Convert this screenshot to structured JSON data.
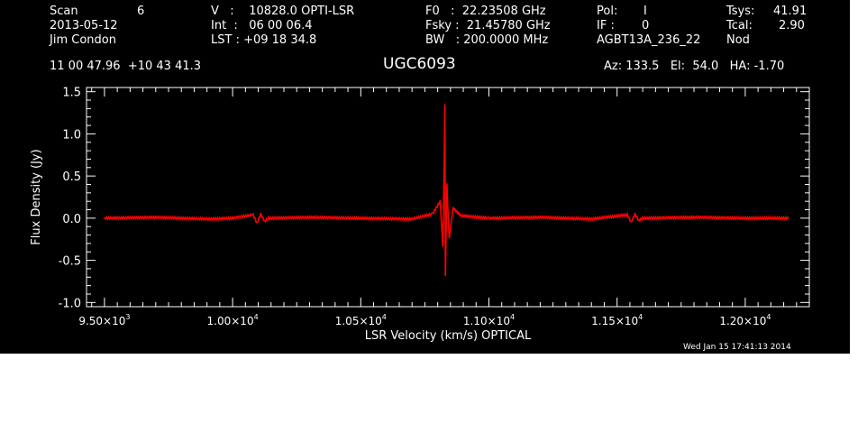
{
  "header": {
    "scan_label": "Scan",
    "scan_value": "6",
    "date": "2013-05-12",
    "observer": "Jim Condon",
    "v_line": "V   :    10828.0 OPTI-LSR",
    "int_line": "Int  :   06 00 06.4",
    "lst_line": "LST : +09 18 34.8",
    "f0_line": "F0   :  22.23508 GHz",
    "fsky_line": "Fsky :  21.45780 GHz",
    "bw_line": "BW   : 200.0000 MHz",
    "pol_label": "Pol:",
    "pol_value": "I",
    "if_label": "IF :",
    "if_value": "0",
    "project": "AGBT13A_236_22",
    "tsys_label": "Tsys:",
    "tsys_value": "41.91",
    "tcal_label": "Tcal:",
    "tcal_value": "2.90",
    "mode": "Nod",
    "coords": "11 00 47.96  +10 43 41.3",
    "source": "UGC6093",
    "az_el_ha": "Az: 133.5   El:  54.0   HA: -1.70"
  },
  "footer": {
    "timestamp": "Wed Jan 15 17:41:13 2014"
  },
  "colors": {
    "background": "#000000",
    "axes": "#ffffff",
    "trace": "#ff0000"
  },
  "chart_data": {
    "type": "line",
    "xlabel": "LSR Velocity (km/s) OPTICAL",
    "ylabel": "Flux Density (Jy)",
    "xlim": [
      9430,
      12250
    ],
    "ylim": [
      -1.05,
      1.55
    ],
    "x_ticks": [
      {
        "value": 9500,
        "mantissa": "9.50",
        "exp": "3"
      },
      {
        "value": 10000,
        "mantissa": "1.00",
        "exp": "4"
      },
      {
        "value": 10500,
        "mantissa": "1.05",
        "exp": "4"
      },
      {
        "value": 11000,
        "mantissa": "1.10",
        "exp": "4"
      },
      {
        "value": 11500,
        "mantissa": "1.15",
        "exp": "4"
      },
      {
        "value": 12000,
        "mantissa": "1.20",
        "exp": "4"
      }
    ],
    "y_ticks": [
      {
        "value": 1.5,
        "label": "1.5"
      },
      {
        "value": 1.0,
        "label": "1.0"
      },
      {
        "value": 0.5,
        "label": "0.5"
      },
      {
        "value": 0.0,
        "label": "0.0"
      },
      {
        "value": -0.5,
        "label": "-0.5"
      },
      {
        "value": -1.0,
        "label": "-1.0"
      }
    ],
    "grid": false,
    "series": [
      {
        "x": [
          9500,
          9700,
          9900,
          10000,
          10080,
          10095,
          10110,
          10125,
          10140,
          10300,
          10500,
          10700,
          10780,
          10810,
          10820,
          10826,
          10828,
          10830,
          10836,
          10845,
          10860,
          10890,
          11000,
          11200,
          11400,
          11540,
          11555,
          11570,
          11585,
          11600,
          11800,
          12000,
          12170
        ],
        "y": [
          0.0,
          0.01,
          -0.01,
          0.0,
          0.04,
          -0.06,
          0.05,
          -0.04,
          0.0,
          0.01,
          0.0,
          -0.01,
          0.05,
          0.2,
          -0.35,
          0.75,
          1.34,
          -0.7,
          0.4,
          -0.25,
          0.12,
          0.03,
          0.0,
          0.01,
          -0.01,
          0.04,
          -0.05,
          0.05,
          -0.03,
          0.0,
          0.01,
          0.0,
          0.0
        ]
      }
    ]
  }
}
